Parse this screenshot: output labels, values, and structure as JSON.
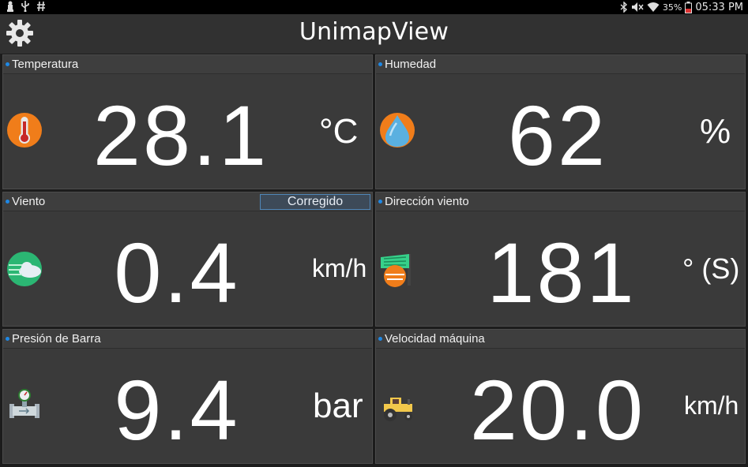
{
  "status_bar": {
    "battery": "35%",
    "time": "05:33 PM",
    "left_icons": [
      "chess-icon",
      "usb-icon",
      "hash-icon"
    ],
    "right_icons": [
      "bluetooth-icon",
      "mute-icon",
      "wifi-icon",
      "battery-icon"
    ]
  },
  "app": {
    "title": "UnimapView",
    "settings_icon": "gear-icon"
  },
  "panels": [
    {
      "label": "Temperatura",
      "value": "28.1",
      "unit": "°C",
      "icon": "thermometer-icon"
    },
    {
      "label": "Humedad",
      "value": "62",
      "unit": "%",
      "icon": "water-drop-icon"
    },
    {
      "label": "Viento",
      "value": "0.4",
      "unit": "km/h",
      "icon": "wind-cloud-icon",
      "badge": "Corregido"
    },
    {
      "label": "Dirección viento",
      "value": "181",
      "unit": "° (S)",
      "icon": "wind-direction-icon"
    },
    {
      "label": "Presión de Barra",
      "value": "9.4",
      "unit": "bar",
      "icon": "pressure-gauge-icon"
    },
    {
      "label": "Velocidad máquina",
      "value": "20.0",
      "unit": "km/h",
      "icon": "tractor-icon"
    }
  ],
  "colors": {
    "panel_bg": "#3a3a3a",
    "action_bar": "#313131",
    "accent_dot": "#1e88e5",
    "icon_orange": "#f07d1a"
  }
}
